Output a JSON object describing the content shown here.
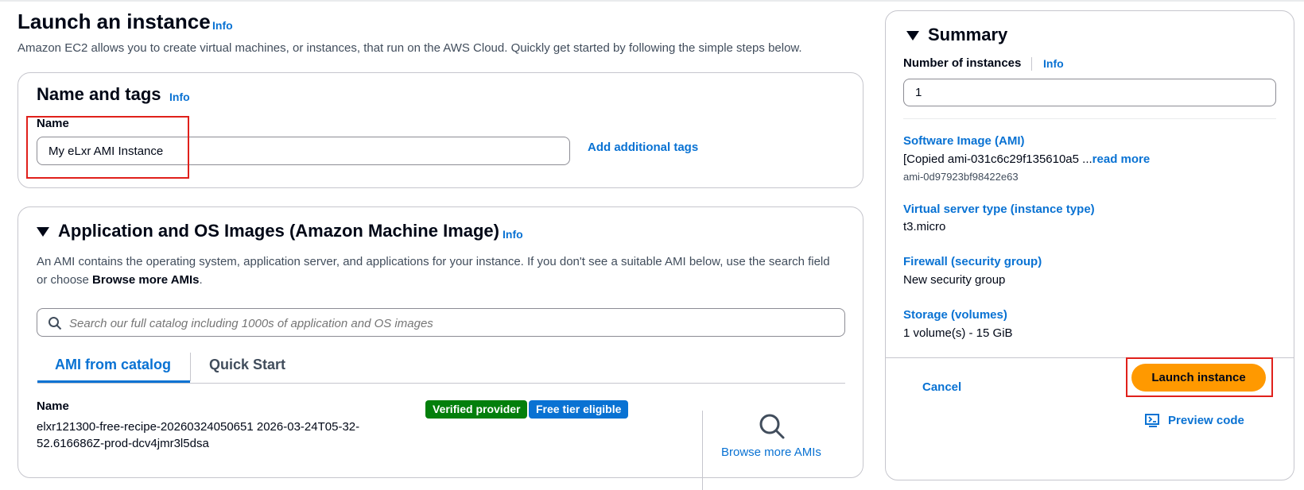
{
  "header": {
    "title": "Launch an instance",
    "info": "Info",
    "description": "Amazon EC2 allows you to create virtual machines, or instances, that run on the AWS Cloud. Quickly get started by following the simple steps below."
  },
  "name_tags": {
    "heading": "Name and tags",
    "info": "Info",
    "name_label": "Name",
    "name_value": "My eLxr AMI Instance",
    "add_tags_label": "Add additional tags"
  },
  "ami": {
    "heading": "Application and OS Images (Amazon Machine Image)",
    "info": "Info",
    "description_prefix": "An AMI contains the operating system, application server, and applications for your instance. If you don't see a suitable AMI below, use the search field or choose ",
    "description_bold": "Browse more AMIs",
    "description_suffix": ".",
    "search_placeholder": "Search our full catalog including 1000s of application and OS images",
    "tabs": [
      "AMI from catalog",
      "Quick Start"
    ],
    "selected": {
      "name_label": "Name",
      "name_value": "elxr121300-free-recipe-20260324050651 2026-03-24T05-32-52.616686Z-prod-dcv4jmr3l5dsa",
      "badges": [
        "Verified provider",
        "Free tier eligible"
      ],
      "badge_colors": [
        "#037f0c",
        "#0972d3"
      ]
    },
    "browse_label": "Browse more AMIs"
  },
  "summary": {
    "heading": "Summary",
    "instances_label": "Number of instances",
    "info": "Info",
    "instances_value": "1",
    "ami_label": "Software Image (AMI)",
    "ami_value": "[Copied ami-031c6c29f135610a5 ...",
    "ami_read_more": "read more",
    "ami_id": "ami-0d97923bf98422e63",
    "type_label": "Virtual server type (instance type)",
    "type_value": "t3.micro",
    "firewall_label": "Firewall (security group)",
    "firewall_value": "New security group",
    "storage_label": "Storage (volumes)",
    "storage_value": "1 volume(s) - 15 GiB",
    "cancel_label": "Cancel",
    "launch_label": "Launch instance",
    "preview_label": "Preview code"
  },
  "colors": {
    "link": "#0972d3",
    "primary_button": "#ff9900",
    "highlight": "#e0201b",
    "text": "#000716"
  }
}
